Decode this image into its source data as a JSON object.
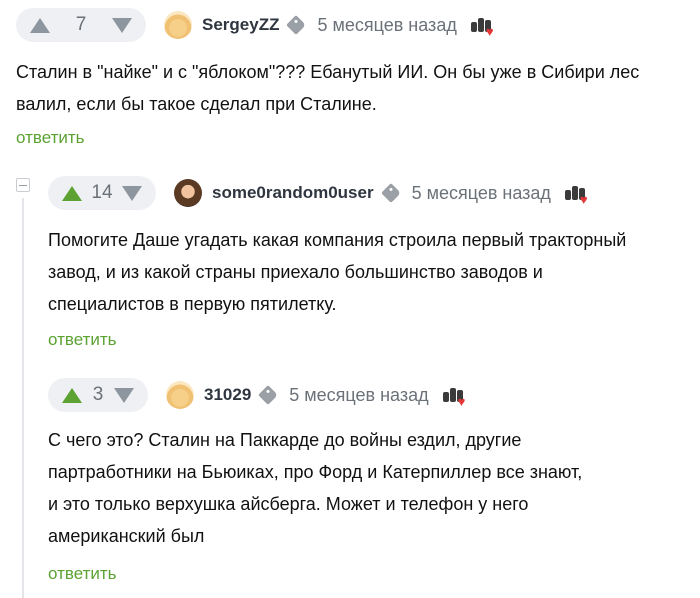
{
  "comments": [
    {
      "votes": "7",
      "username": "SergeyZZ",
      "time": "5 месяцев назад",
      "text_lines": [
        "Сталин в \"найке\" и с \"яблоком\"??? Ебанутый ИИ. Он бы уже в Сибири лес",
        "валил, если бы такое сделал при Сталине."
      ],
      "reply": "ответить",
      "avatar_icon": "bear-avatar"
    },
    {
      "votes": "14",
      "username": "some0random0user",
      "time": "5 месяцев назад",
      "text_lines": [
        "Помогите Даше угадать какая компания строила первый тракторный",
        "завод, и из какой страны приехало большинство заводов и",
        "специалистов в первую пятилетку."
      ],
      "reply": "ответить",
      "avatar_icon": "face-avatar"
    },
    {
      "votes": "3",
      "username": "31029",
      "time": "5 месяцев назад",
      "text_lines": [
        "С чего это? Сталин на Паккарде до войны ездил, другие",
        "партработники на Бьюиках, про Форд и Катерпиллер все знают,",
        "и это только верхушка айсберга. Может и телефон у него",
        "американский был"
      ],
      "reply": "ответить",
      "avatar_icon": "bear-avatar"
    }
  ],
  "colors": {
    "accent_green": "#5ba232",
    "muted": "#6b7178",
    "vote_bg": "#eef0f3"
  }
}
